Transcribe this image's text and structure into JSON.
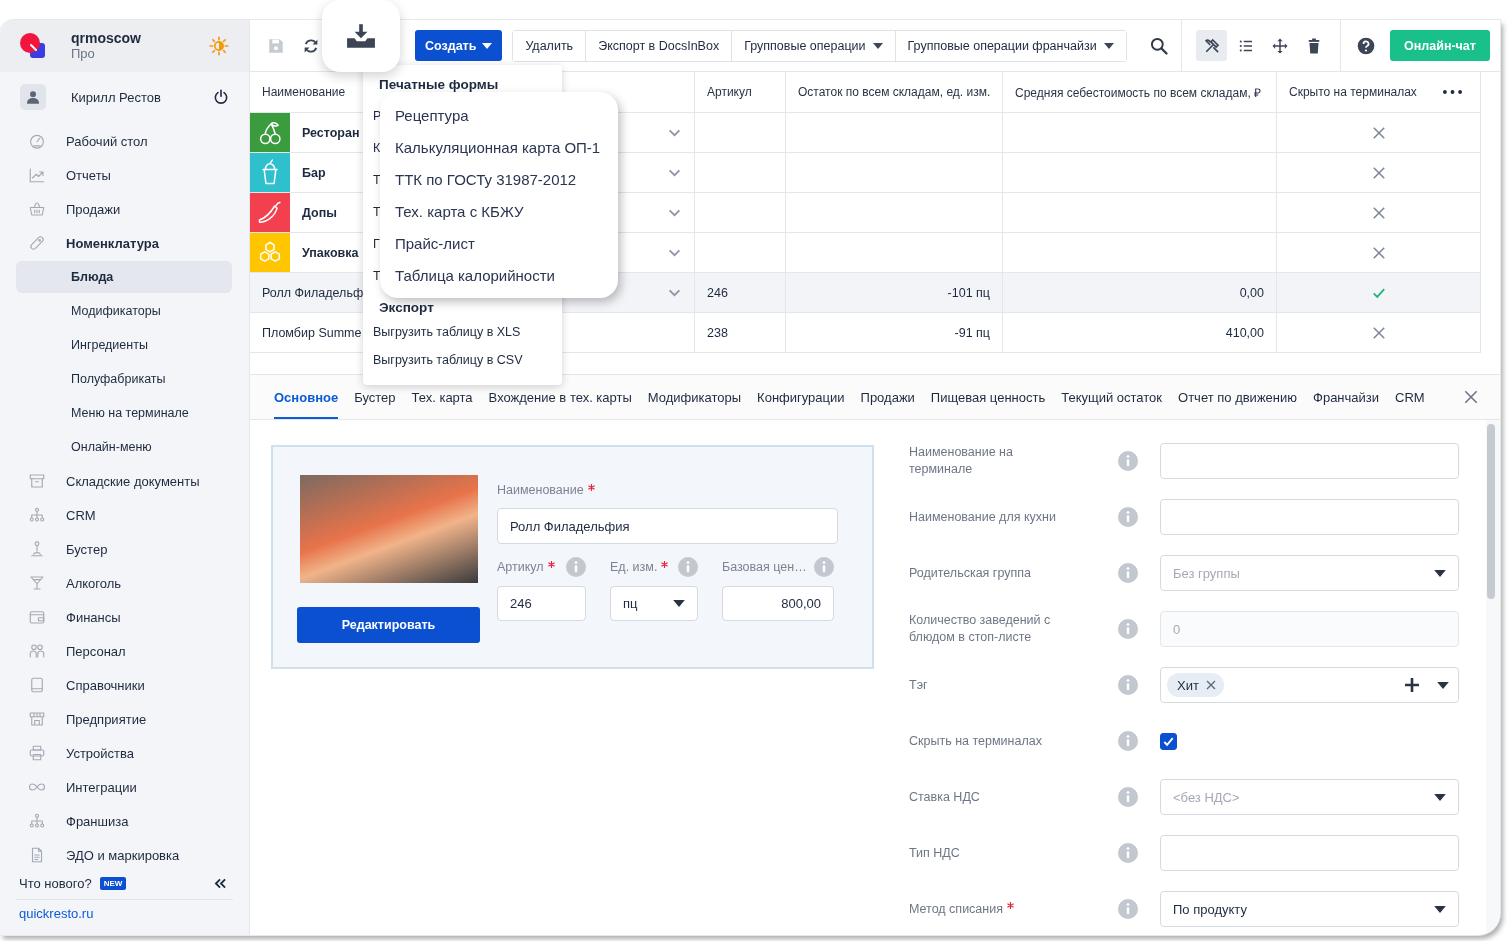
{
  "sidebar": {
    "account": {
      "name": "qrmoscow",
      "plan": "Про"
    },
    "user": "Кирилл Рестов",
    "nav": [
      {
        "label": "Рабочий стол",
        "expanded": false
      },
      {
        "label": "Отчеты",
        "expanded": false
      },
      {
        "label": "Продажи",
        "expanded": false
      },
      {
        "label": "Номенклатура",
        "expanded": true,
        "children": [
          {
            "label": "Блюда",
            "selected": true
          },
          {
            "label": "Модификаторы",
            "selected": false
          },
          {
            "label": "Ингредиенты",
            "selected": false
          },
          {
            "label": "Полуфабрикаты",
            "selected": false
          },
          {
            "label": "Меню на терминале",
            "selected": false
          },
          {
            "label": "Онлайн-меню",
            "selected": false
          }
        ]
      },
      {
        "label": "Складские документы",
        "expanded": false
      },
      {
        "label": "CRM",
        "expanded": false
      },
      {
        "label": "Бустер",
        "expanded": false
      },
      {
        "label": "Алкоголь",
        "expanded": false
      },
      {
        "label": "Финансы",
        "expanded": false
      },
      {
        "label": "Персонал",
        "expanded": false
      },
      {
        "label": "Справочники",
        "expanded": false
      },
      {
        "label": "Предприятие",
        "expanded": false
      },
      {
        "label": "Устройства",
        "expanded": false
      },
      {
        "label": "Интеграции",
        "expanded": false
      },
      {
        "label": "Франшиза",
        "expanded": false
      },
      {
        "label": "ЭДО и маркировка",
        "expanded": false
      }
    ],
    "whats_new": {
      "label": "Что нового?",
      "badge": "NEW"
    },
    "site_link": "quickresto.ru"
  },
  "toolbar": {
    "save_disabled": true,
    "create_button": "Создать",
    "actions": [
      {
        "label": "Удалить",
        "has_menu": false
      },
      {
        "label": "Экспорт в DocsInBox",
        "has_menu": false
      },
      {
        "label": "Групповые операции",
        "has_menu": true
      },
      {
        "label": "Групповые операции франчайзи",
        "has_menu": true
      }
    ],
    "tools": [
      {
        "selected": true
      },
      {
        "selected": false
      },
      {
        "selected": false
      },
      {
        "selected": false
      }
    ],
    "chat_button": "Онлайн-чат"
  },
  "table": {
    "columns": [
      "Наименование",
      "Артикул",
      "Остаток по всем складам, ед. изм.",
      "Средняя себестоимость по всем складам, ₽",
      "Скрыто на терминалах"
    ],
    "rows": [
      {
        "kind": "group",
        "name": "Ресторан",
        "color": "#3a9c3d",
        "hidden": false,
        "selected": false
      },
      {
        "kind": "group",
        "name": "Бар",
        "color": "#2ec0cc",
        "hidden": false,
        "selected": false
      },
      {
        "kind": "group",
        "name": "Допы",
        "color": "#f2404f",
        "hidden": false,
        "selected": false
      },
      {
        "kind": "group",
        "name": "Упаковка",
        "color": "#ffc600",
        "hidden": false,
        "selected": false
      },
      {
        "kind": "item",
        "name": "Ролл Филадельф",
        "article": "246",
        "stock": "-101 пц",
        "cost": "0,00",
        "hidden": true,
        "selected": true
      },
      {
        "kind": "item",
        "name": "Пломбир Summe",
        "article": "238",
        "stock": "-91 пц",
        "cost": "410,00",
        "hidden": false,
        "selected": false
      }
    ]
  },
  "menu": {
    "print_title": "Печатные формы",
    "print_items": [
      "Р",
      "К",
      "Т",
      "Т",
      "Г",
      "Т"
    ],
    "export_title": "Экспорт",
    "export_items": [
      "Выгрузить таблицу в XLS",
      "Выгрузить таблицу в CSV"
    ]
  },
  "print_forms_popout": {
    "items": [
      "Рецептура",
      "Калькуляционная карта ОП-1",
      "ТТК по ГОСТу 31987-2012",
      "Тех. карта с КБЖУ",
      "Прайс-лист",
      "Таблица калорийности"
    ]
  },
  "detail": {
    "tabs": [
      {
        "label": "Основное",
        "selected": true
      },
      {
        "label": "Бустер",
        "selected": false
      },
      {
        "label": "Тех. карта",
        "selected": false
      },
      {
        "label": "Вхождение в тех. карты",
        "selected": false
      },
      {
        "label": "Модификаторы",
        "selected": false
      },
      {
        "label": "Конфигурации",
        "selected": false
      },
      {
        "label": "Продажи",
        "selected": false
      },
      {
        "label": "Пищевая ценность",
        "selected": false
      },
      {
        "label": "Текущий остаток",
        "selected": false
      },
      {
        "label": "Отчет по движению",
        "selected": false
      },
      {
        "label": "Франчайзи",
        "selected": false
      },
      {
        "label": "CRM",
        "selected": false
      }
    ],
    "card": {
      "edit_button": "Редактировать",
      "name_field": {
        "label": "Наименование",
        "required": true,
        "info": false,
        "value": "Ролл Филадельфия"
      },
      "fields": [
        {
          "kind": "text",
          "label": "Артикул",
          "required": true,
          "info": true,
          "value": "246"
        },
        {
          "kind": "select",
          "label": "Ед. изм.",
          "required": true,
          "info": true,
          "value": "пц"
        },
        {
          "kind": "number",
          "label": "Базовая цен…",
          "required": false,
          "info": true,
          "value": "800,00"
        }
      ]
    },
    "form": [
      {
        "kind": "text",
        "label": "Наименование на терминале",
        "required": false,
        "disabled": false
      },
      {
        "kind": "text",
        "label": "Наименование для кухни",
        "required": false,
        "disabled": false
      },
      {
        "kind": "select",
        "label": "Родительская группа",
        "required": false,
        "placeholder": "Без группы"
      },
      {
        "kind": "text",
        "label": "Количество заведений с блюдом в стоп-листе",
        "required": false,
        "disabled": true,
        "placeholder": "0"
      },
      {
        "kind": "tags",
        "label": "Тэг",
        "required": false,
        "tags": [
          "Хит"
        ]
      },
      {
        "kind": "checkbox",
        "label": "Скрыть на терминалах",
        "required": false,
        "checked": true
      },
      {
        "kind": "select",
        "label": "Ставка НДС",
        "required": false,
        "placeholder": "<без НДС>"
      },
      {
        "kind": "text",
        "label": "Тип НДС",
        "required": false,
        "disabled": false
      },
      {
        "kind": "select",
        "label": "Метод списания",
        "required": true,
        "value": "По продукту"
      }
    ]
  }
}
